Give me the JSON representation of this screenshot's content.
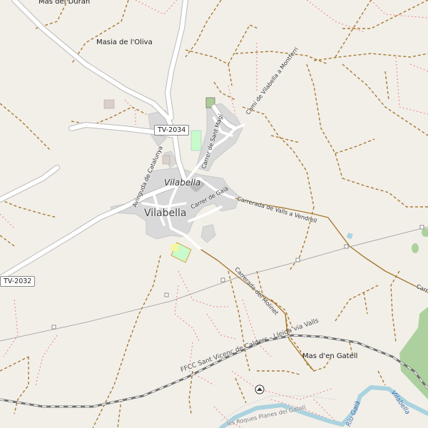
{
  "places": {
    "mas_del_duran": "Mas del Duran",
    "masia_oliva": "Masia de l'Oliva",
    "vilabella_main": "Vilabella",
    "vilabella_italic": "Vilabella",
    "mas_den_gatell": "Mas d'en Gatell",
    "vilabella_small": "Vilabella"
  },
  "roads": {
    "tv2034": "TV-2034",
    "tv2032": "TV-2032"
  },
  "streets": {
    "cami_montferri": "Camí de Vilabella a Montferri",
    "carrer_sant_magi": "Carrer de Sant Magí",
    "avinguda_catalunya": "Avinguda de Catalunya",
    "carrer_gaia": "Carrer de Gaià",
    "carrerada_valls": "Carrerada de Valls a Vendrell",
    "carrerada_molinet": "Carrerada del Molinet",
    "carr_edge": "Carr"
  },
  "railway": {
    "label": "FFCC Sant Vicenç de Calders - Lleida via Valls"
  },
  "river": {
    "label": "Riu Gaià"
  },
  "bottom_text": {
    "label": "les Roques Planes del Gatell"
  },
  "icons": {
    "peak": "viewpoint-icon"
  },
  "colors": {
    "background": "#f2efe9",
    "urban": "#d9d9d9",
    "track": "#a87a30",
    "path": "#f08080",
    "water": "#aad3df",
    "forest": "#add19e",
    "road": "#ffffff"
  }
}
